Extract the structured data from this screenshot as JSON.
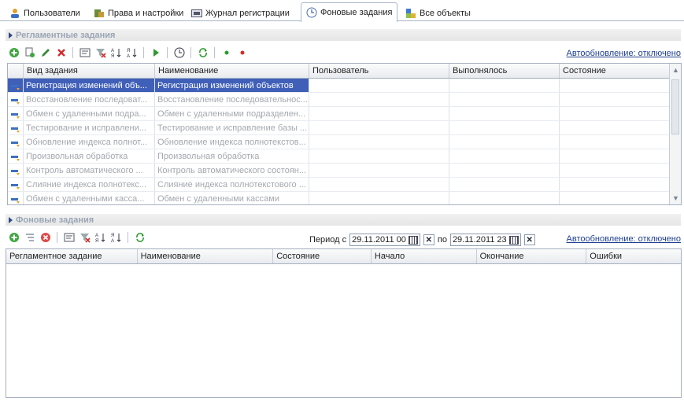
{
  "tabs": [
    {
      "label": "Пользователи",
      "icon": "users-icon"
    },
    {
      "label": "Права и настройки",
      "icon": "rights-icon"
    },
    {
      "label": "Журнал регистрации",
      "icon": "journal-icon"
    },
    {
      "label": "Фоновые задания",
      "icon": "clock-icon",
      "active": true
    },
    {
      "label": "Все объекты",
      "icon": "objects-icon"
    }
  ],
  "scheduled": {
    "header": "Регламентные задания",
    "autorefresh": "Автообновление: отключено",
    "columns": [
      "Вид задания",
      "Наименование",
      "Пользователь",
      "Выполнялось",
      "Состояние"
    ],
    "rows": [
      {
        "kind": "Регистрация изменений объ...",
        "name": "Регистрация изменений объектов",
        "selected": true
      },
      {
        "kind": "Восстановление последоват...",
        "name": "Восстановление последовательнос..."
      },
      {
        "kind": "Обмен с удаленными подра...",
        "name": "Обмен с удаленными подразделен..."
      },
      {
        "kind": "Тестирование и исправлени...",
        "name": "Тестирование и исправление базы ..."
      },
      {
        "kind": "Обновление индекса полнот...",
        "name": "Обновление индекса полнотекстов..."
      },
      {
        "kind": "Произвольная обработка",
        "name": "Произвольная обработка"
      },
      {
        "kind": "Контроль автоматического ...",
        "name": "Контроль автоматического состоян..."
      },
      {
        "kind": "Слияние индекса полнотекс...",
        "name": "Слияние индекса полнотекстового ..."
      },
      {
        "kind": "Обмен с удаленными касса...",
        "name": "Обмен с удаленными кассами"
      }
    ]
  },
  "background": {
    "header": "Фоновые задания",
    "autorefresh": "Автообновление: отключено",
    "period_label": "Период с",
    "period_to_label": "по",
    "period_from": "29.11.2011 00",
    "period_to": "29.11.2011 23",
    "columns": [
      "Регламентное задание",
      "Наименование",
      "Состояние",
      "Начало",
      "Окончание",
      "Ошибки"
    ]
  },
  "colors": {
    "selection": "#3f5fb8",
    "link": "#1f3f8f",
    "header_text": "#9aa6b5"
  }
}
